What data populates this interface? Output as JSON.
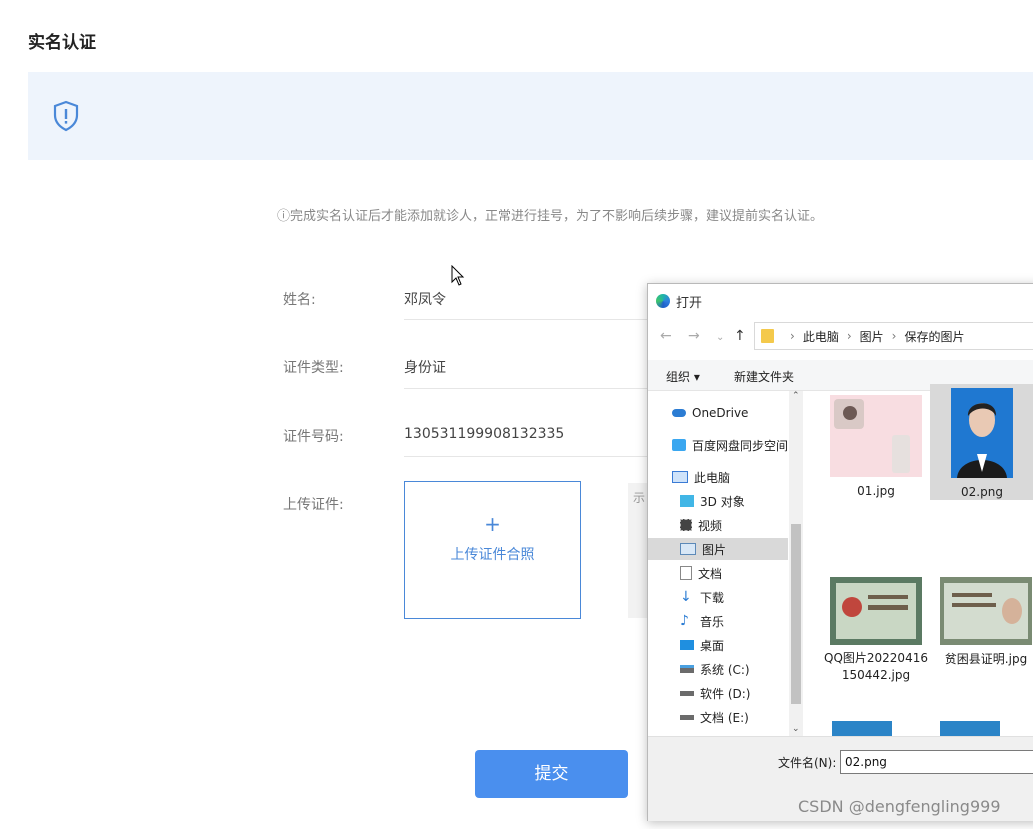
{
  "page": {
    "title": "实名认证",
    "notice": "完成实名认证后才能添加就诊人，正常进行挂号，为了不影响后续步骤，建议提前实名认证。",
    "form": {
      "name_label": "姓名:",
      "name_value": "邓凤令",
      "id_type_label": "证件类型:",
      "id_type_value": "身份证",
      "id_number_label": "证件号码:",
      "id_number_value": "130531199908132335",
      "upload_label": "上传证件:",
      "upload_plus": "+",
      "upload_text": "上传证件合照",
      "sample_text": "示"
    },
    "submit_label": "提交"
  },
  "dialog": {
    "title": "打开",
    "breadcrumb": [
      "此电脑",
      "图片",
      "保存的图片"
    ],
    "toolbar": {
      "organize": "组织 ▾",
      "new_folder": "新建文件夹"
    },
    "nav_items": [
      {
        "label": "OneDrive",
        "icon": "cloud-icon"
      },
      {
        "label": "百度网盘同步空间",
        "icon": "baidu-icon"
      },
      {
        "label": "此电脑",
        "icon": "computer-icon"
      },
      {
        "label": "3D 对象",
        "icon": "cube-icon"
      },
      {
        "label": "视频",
        "icon": "video-icon"
      },
      {
        "label": "图片",
        "icon": "pictures-icon"
      },
      {
        "label": "文档",
        "icon": "document-icon"
      },
      {
        "label": "下载",
        "icon": "download-icon"
      },
      {
        "label": "音乐",
        "icon": "music-icon"
      },
      {
        "label": "桌面",
        "icon": "desktop-icon"
      },
      {
        "label": "系统 (C:)",
        "icon": "drive-icon"
      },
      {
        "label": "软件 (D:)",
        "icon": "drive-icon"
      },
      {
        "label": "文档 (E:)",
        "icon": "drive-icon"
      }
    ],
    "files": [
      {
        "name": "01.jpg"
      },
      {
        "name": "02.png"
      },
      {
        "name": "QQ图片20220416150442.jpg"
      },
      {
        "name": "贫困县证明.jpg"
      }
    ],
    "filename_label": "文件名(N):",
    "filename_value": "02.png"
  },
  "watermark": "CSDN @dengfengling999",
  "colors": {
    "accent": "#4a8fee",
    "banner": "#eef4fc",
    "link": "#4a88d8"
  }
}
